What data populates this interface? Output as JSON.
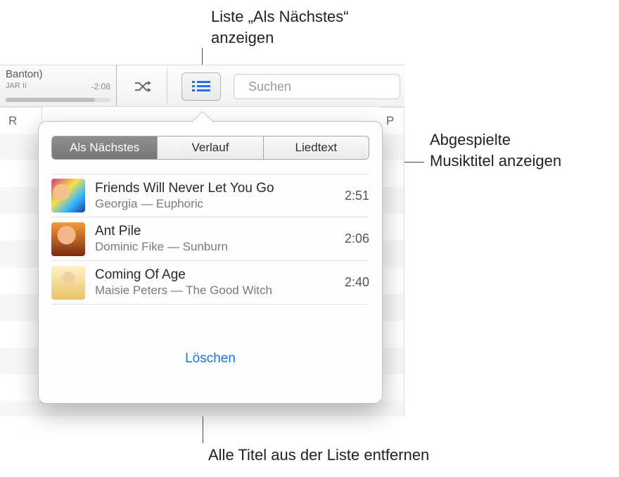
{
  "callouts": {
    "top_line1": "Liste „Als Nächstes“",
    "top_line2": "anzeigen",
    "right_line1": "Abgespielte",
    "right_line2": "Musiktitel anzeigen",
    "bottom": "Alle Titel aus der Liste entfernen"
  },
  "toolbar": {
    "now_playing_line1": "Banton)",
    "now_playing_line2": "JAR II",
    "remaining_time": "-2:08",
    "search_placeholder": "Suchen"
  },
  "columns": {
    "left_header": "R",
    "right_header": "P"
  },
  "popover": {
    "tabs": {
      "upnext": "Als Nächstes",
      "history": "Verlauf",
      "lyrics": "Liedtext"
    },
    "tracks": [
      {
        "title": "Friends Will Never Let You Go",
        "subtitle": "Georgia — Euphoric",
        "duration": "2:51"
      },
      {
        "title": "Ant Pile",
        "subtitle": "Dominic Fike — Sunburn",
        "duration": "2:06"
      },
      {
        "title": "Coming Of Age",
        "subtitle": "Maisie Peters — The Good Witch",
        "duration": "2:40"
      }
    ],
    "clear_label": "Löschen"
  }
}
